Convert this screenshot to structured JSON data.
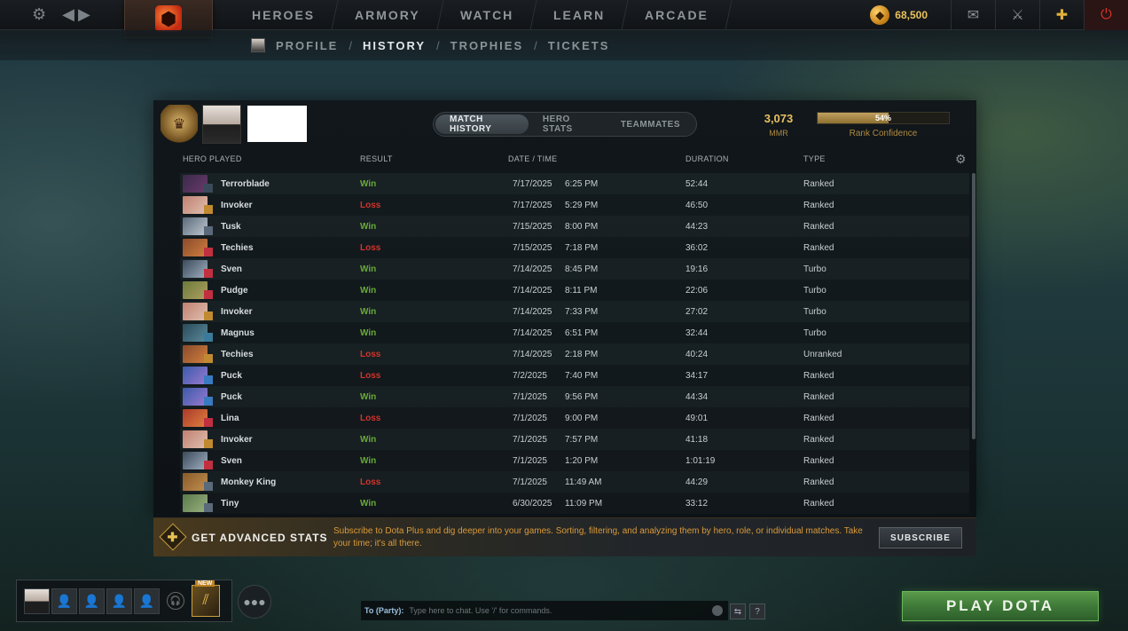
{
  "topnav": {
    "settings_icon": "gear-icon",
    "history_icons": [
      "chevron-left-icon",
      "chevron-right-icon"
    ],
    "logo_icon": "dota-logo-icon",
    "items": [
      "HEROES",
      "ARMORY",
      "WATCH",
      "LEARN",
      "ARCADE"
    ],
    "shards": "68,500",
    "icons": [
      "mail-icon",
      "armor-icon",
      "dota-plus-icon",
      "power-icon"
    ]
  },
  "subnav": {
    "items": [
      "PROFILE",
      "HISTORY",
      "TROPHIES",
      "TICKETS"
    ],
    "active": "HISTORY"
  },
  "profile": {
    "tabs": [
      "MATCH HISTORY",
      "HERO STATS",
      "TEAMMATES"
    ],
    "active_tab": "MATCH HISTORY",
    "mmr_value": "3,073",
    "mmr_label": "MMR",
    "rank_confidence_pct": "54%",
    "rank_confidence_fraction": 0.54,
    "rank_confidence_label": "Rank Confidence"
  },
  "table": {
    "headers": [
      "HERO PLAYED",
      "RESULT",
      "DATE / TIME",
      "DURATION",
      "TYPE"
    ],
    "rows": [
      {
        "hero": "Terrorblade",
        "result": "Win",
        "date": "7/17/2025",
        "time": "6:25 PM",
        "duration": "52:44",
        "type": "Ranked",
        "c1": "#3a2a4a",
        "c2": "#6a3a6a",
        "role": "#3a4a5a"
      },
      {
        "hero": "Invoker",
        "result": "Loss",
        "date": "7/17/2025",
        "time": "5:29 PM",
        "duration": "46:50",
        "type": "Ranked",
        "c1": "#c08070",
        "c2": "#e0c0b0",
        "role": "#c08a30"
      },
      {
        "hero": "Tusk",
        "result": "Win",
        "date": "7/15/2025",
        "time": "8:00 PM",
        "duration": "44:23",
        "type": "Ranked",
        "c1": "#5a6a7a",
        "c2": "#c0c8d0",
        "role": "#5a6a7a"
      },
      {
        "hero": "Techies",
        "result": "Loss",
        "date": "7/15/2025",
        "time": "7:18 PM",
        "duration": "36:02",
        "type": "Ranked",
        "c1": "#8a4a2a",
        "c2": "#d08040",
        "role": "#c03040"
      },
      {
        "hero": "Sven",
        "result": "Win",
        "date": "7/14/2025",
        "time": "8:45 PM",
        "duration": "19:16",
        "type": "Turbo",
        "c1": "#3a4a5a",
        "c2": "#a0b0c0",
        "role": "#c03040"
      },
      {
        "hero": "Pudge",
        "result": "Win",
        "date": "7/14/2025",
        "time": "8:11 PM",
        "duration": "22:06",
        "type": "Turbo",
        "c1": "#6a7a3a",
        "c2": "#b0a060",
        "role": "#c03040"
      },
      {
        "hero": "Invoker",
        "result": "Win",
        "date": "7/14/2025",
        "time": "7:33 PM",
        "duration": "27:02",
        "type": "Turbo",
        "c1": "#c08070",
        "c2": "#e0c0b0",
        "role": "#c08a30"
      },
      {
        "hero": "Magnus",
        "result": "Win",
        "date": "7/14/2025",
        "time": "6:51 PM",
        "duration": "32:44",
        "type": "Turbo",
        "c1": "#2a4a5a",
        "c2": "#5a8a9a",
        "role": "#3a7a9a"
      },
      {
        "hero": "Techies",
        "result": "Loss",
        "date": "7/14/2025",
        "time": "2:18 PM",
        "duration": "40:24",
        "type": "Unranked",
        "c1": "#8a4a2a",
        "c2": "#d08040",
        "role": "#c08a30"
      },
      {
        "hero": "Puck",
        "result": "Loss",
        "date": "7/2/2025",
        "time": "7:40 PM",
        "duration": "34:17",
        "type": "Ranked",
        "c1": "#3a5aaa",
        "c2": "#9a7ad0",
        "role": "#3a7ac0"
      },
      {
        "hero": "Puck",
        "result": "Win",
        "date": "7/1/2025",
        "time": "9:56 PM",
        "duration": "44:34",
        "type": "Ranked",
        "c1": "#3a5aaa",
        "c2": "#9a7ad0",
        "role": "#3a7ac0"
      },
      {
        "hero": "Lina",
        "result": "Loss",
        "date": "7/1/2025",
        "time": "9:00 PM",
        "duration": "49:01",
        "type": "Ranked",
        "c1": "#aa3a2a",
        "c2": "#e08040",
        "role": "#c03040"
      },
      {
        "hero": "Invoker",
        "result": "Win",
        "date": "7/1/2025",
        "time": "7:57 PM",
        "duration": "41:18",
        "type": "Ranked",
        "c1": "#c08070",
        "c2": "#e0c0b0",
        "role": "#c08a30"
      },
      {
        "hero": "Sven",
        "result": "Win",
        "date": "7/1/2025",
        "time": "1:20 PM",
        "duration": "1:01:19",
        "type": "Ranked",
        "c1": "#3a4a5a",
        "c2": "#a0b0c0",
        "role": "#c03040"
      },
      {
        "hero": "Monkey King",
        "result": "Loss",
        "date": "7/1/2025",
        "time": "11:49 AM",
        "duration": "44:29",
        "type": "Ranked",
        "c1": "#8a5a2a",
        "c2": "#c09050",
        "role": "#5a6a7a"
      },
      {
        "hero": "Tiny",
        "result": "Win",
        "date": "6/30/2025",
        "time": "11:09 PM",
        "duration": "33:12",
        "type": "Ranked",
        "c1": "#5a7a4a",
        "c2": "#9ab080",
        "role": "#5a6a7a"
      }
    ]
  },
  "advanced": {
    "title": "GET ADVANCED STATS",
    "description": "Subscribe to Dota Plus and dig deeper into your games. Sorting, filtering, and analyzing them by hero, role, or individual matches. Take your time; it's all there.",
    "subscribe_label": "SUBSCRIBE"
  },
  "bottom": {
    "new_badge": "NEW",
    "chat_to": "To (Party):",
    "chat_placeholder": "Type here to chat. Use '/' for commands.",
    "help_label": "?",
    "play_label": "PLAY DOTA"
  }
}
